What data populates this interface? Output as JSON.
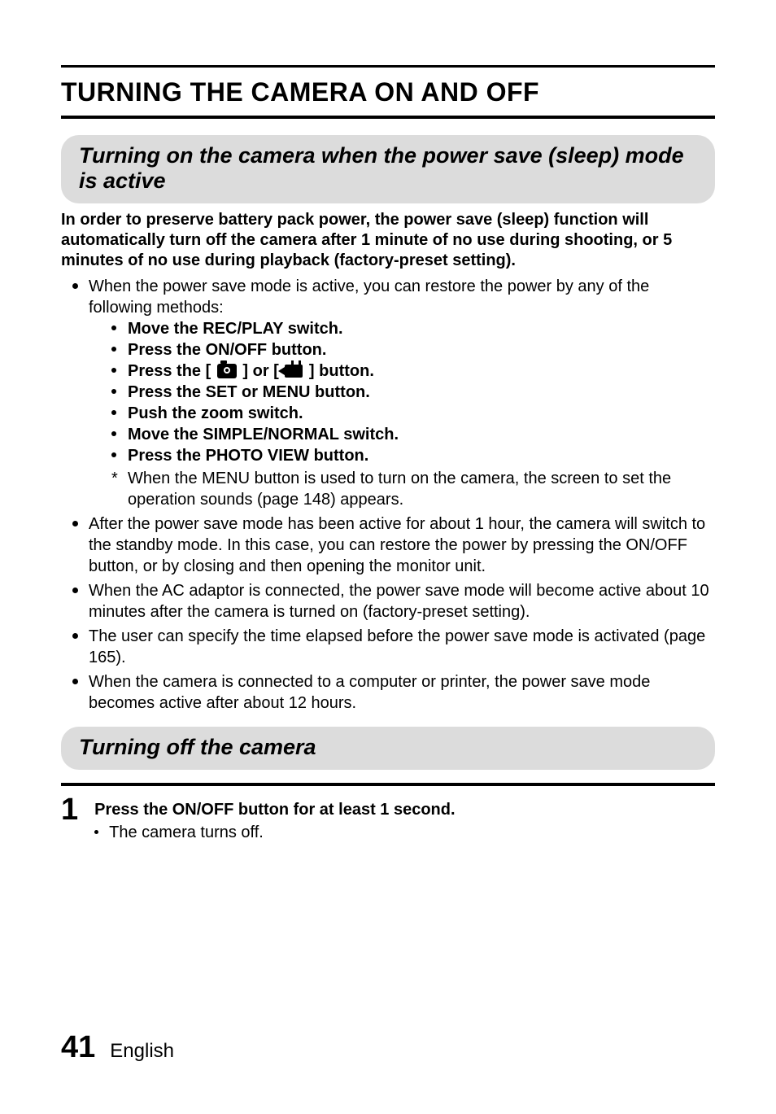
{
  "page_title": "TURNING THE CAMERA ON AND OFF",
  "section1_heading": "Turning on the camera when the power save (sleep) mode is active",
  "intro": "In order to preserve battery pack power, the power save (sleep) function will automatically turn off the camera after 1 minute of no use during shooting, or 5 minutes of no use during playback (factory-preset setting).",
  "restore_intro": "When the power save mode is active, you can restore the power by any of the following methods:",
  "methods": {
    "m1": "Move the REC/PLAY switch.",
    "m2": "Press the ON/OFF button.",
    "m3a": "Press the [ ",
    "m3b": " ] or [ ",
    "m3c": " ] button.",
    "m4": "Press the SET or MENU button.",
    "m5": "Push the zoom switch.",
    "m6": "Move the SIMPLE/NORMAL switch.",
    "m7": "Press the PHOTO VIEW button."
  },
  "note": "When the MENU button is used to turn on the camera, the screen to set the operation sounds (page 148) appears.",
  "bullets": {
    "b2": "After the power save mode has been active for about 1 hour, the camera will switch to the standby mode. In this case, you can restore the power by pressing the ON/OFF button, or by closing and then opening the monitor unit.",
    "b3": "When the AC adaptor is connected, the power save mode will become active about 10 minutes after the camera is turned on (factory-preset setting).",
    "b4": "The user can specify the time elapsed before the power save mode is activated (page 165).",
    "b5": "When the camera is connected to a computer or printer, the power save mode becomes active after about 12 hours."
  },
  "section2_heading": "Turning off the camera",
  "step": {
    "num": "1",
    "main": "Press the ON/OFF button for at least 1 second.",
    "sub": "The camera turns off."
  },
  "footer": {
    "page": "41",
    "lang": "English"
  }
}
